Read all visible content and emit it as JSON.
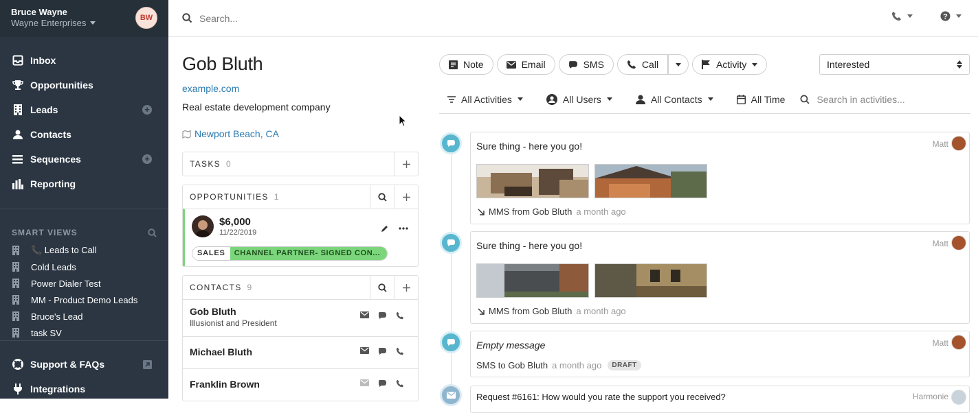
{
  "user": {
    "name": "Bruce Wayne",
    "org": "Wayne Enterprises",
    "initials": "BW"
  },
  "nav": [
    {
      "label": "Inbox",
      "icon": "inbox-icon"
    },
    {
      "label": "Opportunities",
      "icon": "trophy-icon"
    },
    {
      "label": "Leads",
      "icon": "building-icon"
    },
    {
      "label": "Contacts",
      "icon": "person-icon"
    },
    {
      "label": "Sequences",
      "icon": "list-icon"
    },
    {
      "label": "Reporting",
      "icon": "bar-chart-icon"
    }
  ],
  "smart_views": {
    "title": "SMART VIEWS",
    "items": [
      "📞 Leads to Call",
      "Cold Leads",
      "Power Dialer Test",
      "MM - Product Demo Leads",
      "Bruce's Lead",
      "task SV"
    ]
  },
  "bottom_nav": [
    {
      "label": "Support & FAQs",
      "icon": "lifebuoy-icon"
    },
    {
      "label": "Integrations",
      "icon": "plug-icon"
    }
  ],
  "search": {
    "placeholder": "Search..."
  },
  "lead": {
    "name": "Gob Bluth",
    "url": "example.com",
    "description": "Real estate development company",
    "location": "Newport Beach, CA"
  },
  "tasks": {
    "title": "TASKS",
    "count": "0"
  },
  "opportunities": {
    "title": "OPPORTUNITIES",
    "count": "1",
    "item": {
      "value": "$6,000",
      "date": "11/22/2019",
      "pipeline": "SALES",
      "status": "CHANNEL PARTNER- SIGNED CON..."
    }
  },
  "contacts": {
    "title": "CONTACTS",
    "count": "9",
    "items": [
      {
        "name": "Gob Bluth",
        "title": "Illusionist and President"
      },
      {
        "name": "Michael Bluth",
        "title": ""
      },
      {
        "name": "Franklin Brown",
        "title": ""
      }
    ]
  },
  "actions": {
    "note": "Note",
    "email": "Email",
    "sms": "SMS",
    "call": "Call",
    "activity": "Activity"
  },
  "status": "Interested",
  "filters": {
    "activities": "All Activities",
    "users": "All Users",
    "contacts": "All Contacts",
    "time": "All Time",
    "search_placeholder": "Search in activities..."
  },
  "events": [
    {
      "text": "Sure thing - here you go!",
      "user": "Matt",
      "foot": "MMS from Gob Bluth",
      "ago": "a month ago"
    },
    {
      "text": "Sure thing - here you go!",
      "user": "Matt",
      "foot": "MMS from Gob Bluth",
      "ago": "a month ago"
    },
    {
      "text": "Empty message",
      "user": "Matt",
      "foot": "SMS to Gob Bluth",
      "ago": "a month ago",
      "badge": "DRAFT"
    },
    {
      "text": "Request #6161: How would you rate the support you received?",
      "user": "Harmonie"
    }
  ]
}
